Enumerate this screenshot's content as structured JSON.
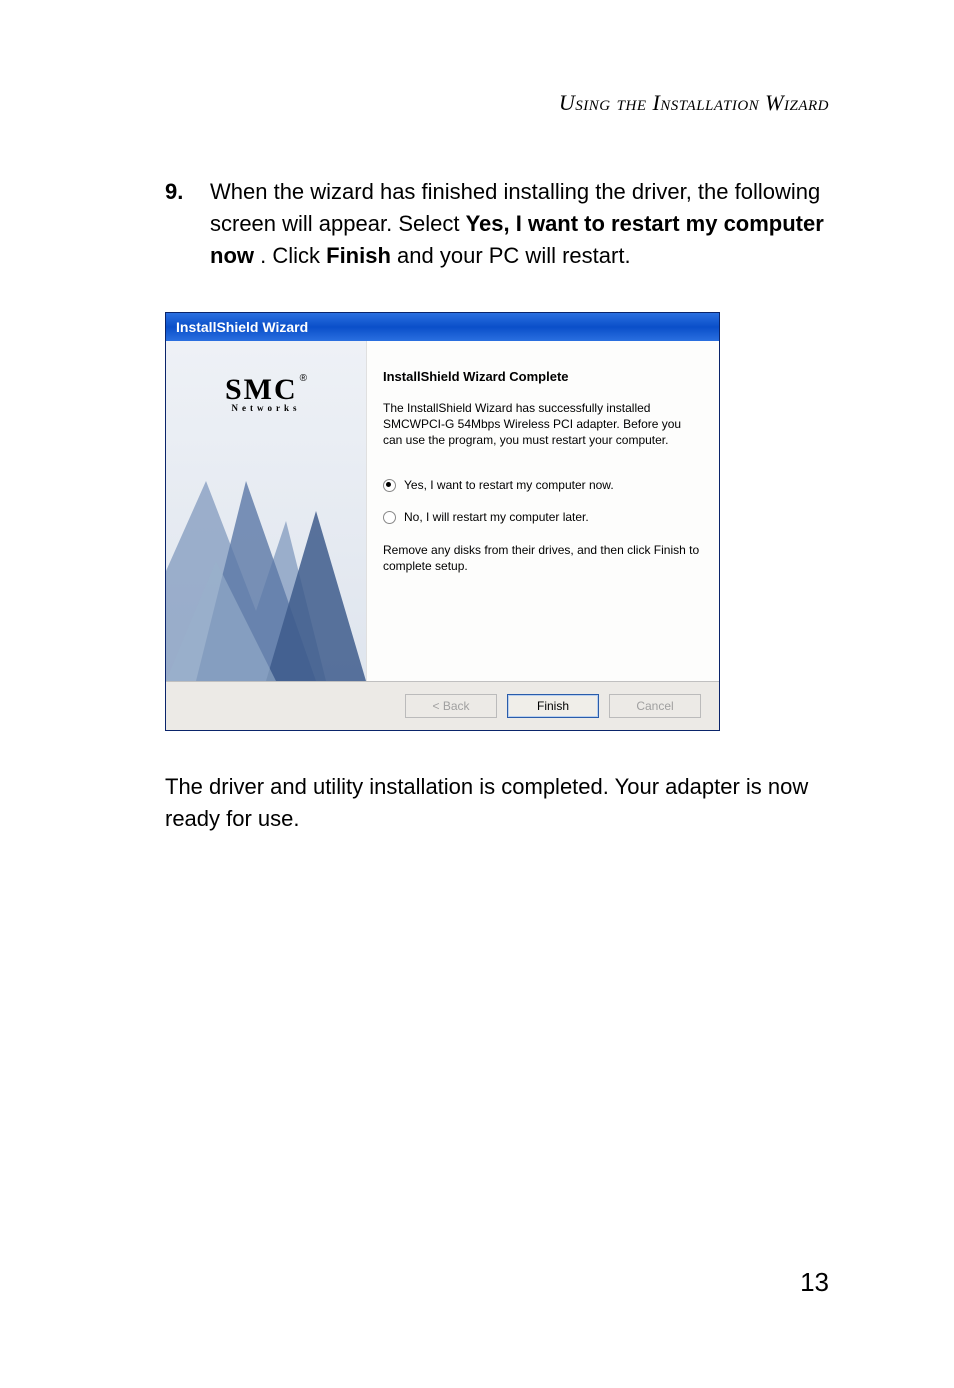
{
  "header": {
    "title": "Using the Installation Wizard"
  },
  "step": {
    "number": "9.",
    "text_before_bold1": "When the wizard has finished installing the driver, the following screen will appear. Select ",
    "bold1": "Yes, I want to restart my computer now",
    "text_mid": ". Click ",
    "bold2": "Finish",
    "text_after": " and your PC will restart."
  },
  "dialog": {
    "title": "InstallShield Wizard",
    "logo_main": "SMC",
    "logo_reg": "®",
    "logo_sub": "Networks",
    "panel_title": "InstallShield Wizard Complete",
    "panel_desc": "The InstallShield Wizard has successfully installed SMCWPCI-G 54Mbps Wireless PCI adapter.  Before you can use the program, you must restart your computer.",
    "radio_yes": "Yes, I want to restart my computer now.",
    "radio_no": "No, I will restart my computer later.",
    "note": "Remove any disks from their drives, and then click Finish to complete setup.",
    "buttons": {
      "back": "< Back",
      "finish": "Finish",
      "cancel": "Cancel"
    },
    "selected_option": "yes"
  },
  "outro": "The driver and utility installation is completed. Your adapter is now ready for use.",
  "page_number": "13"
}
